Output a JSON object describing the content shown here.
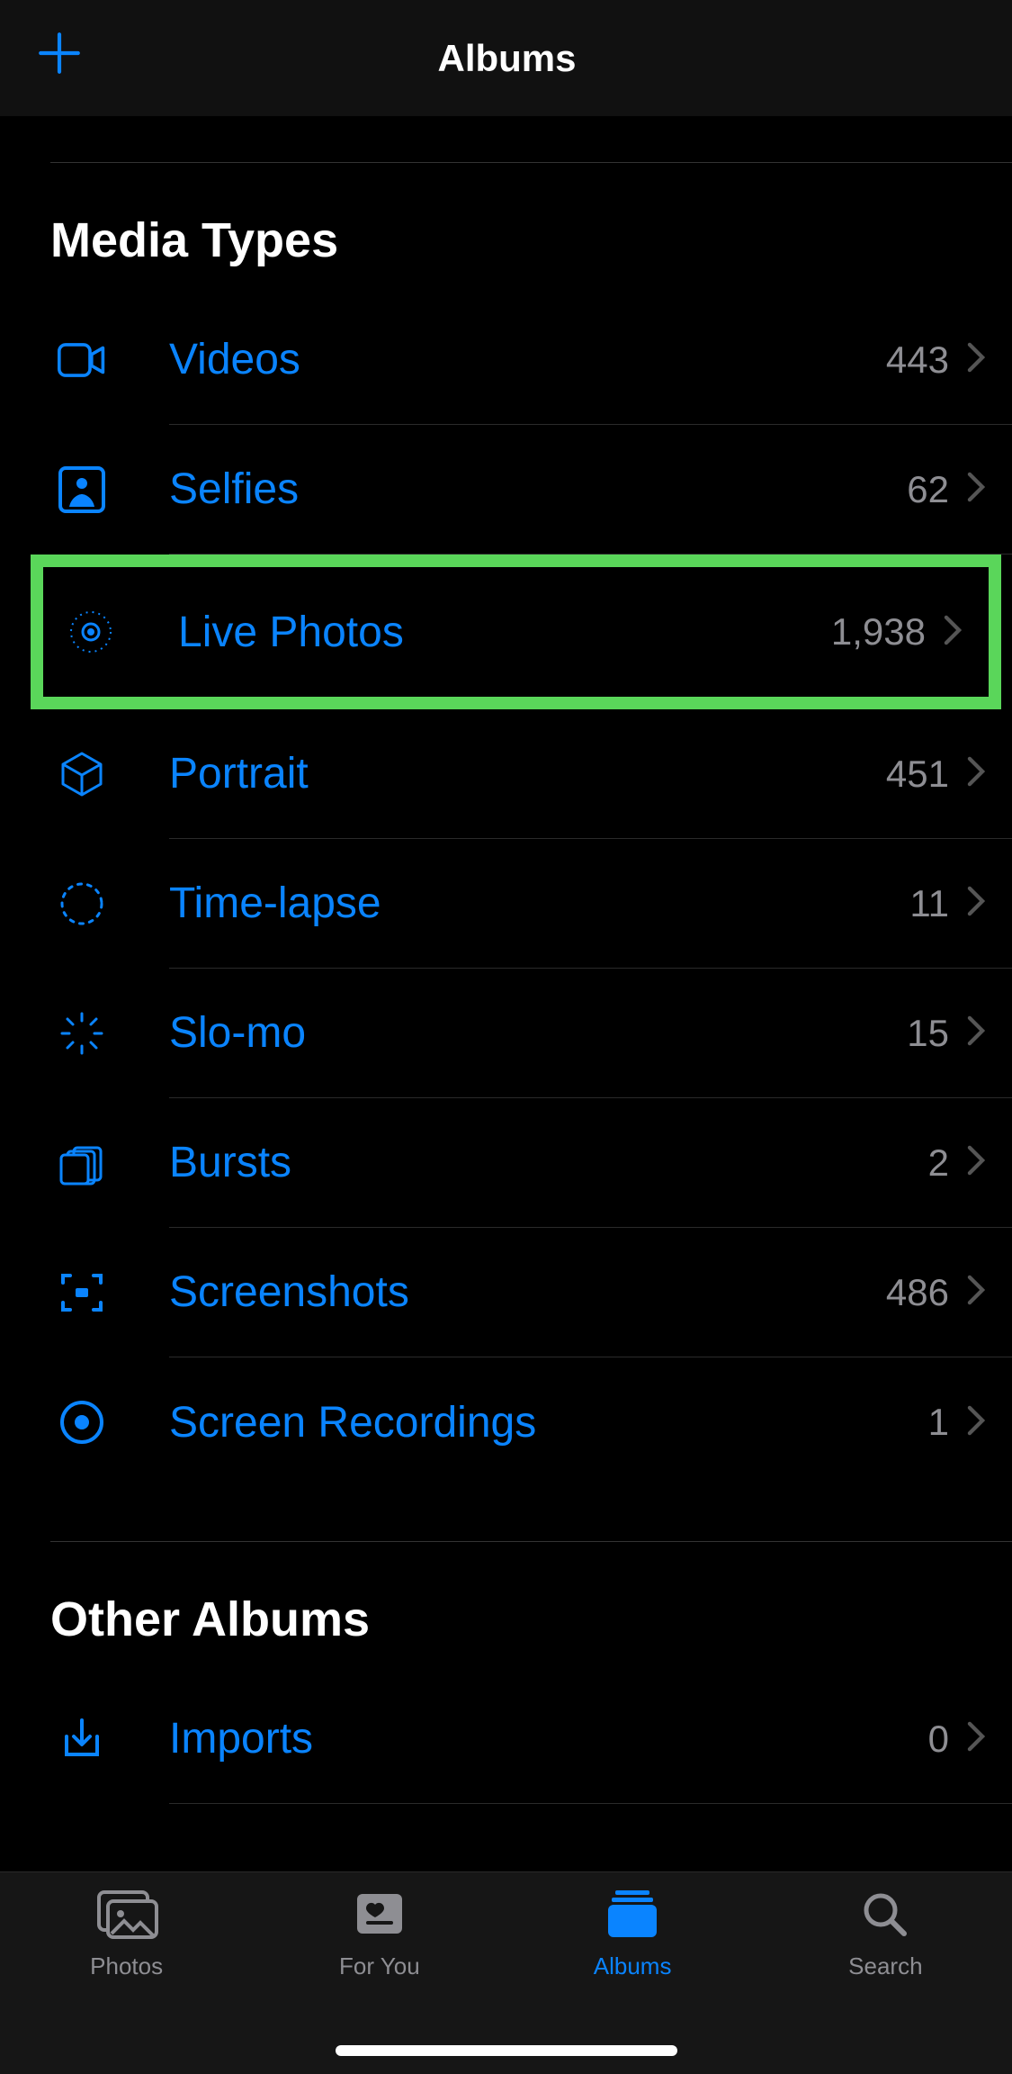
{
  "navbar": {
    "title": "Albums"
  },
  "sections": {
    "media": {
      "header": "Media Types",
      "items": [
        {
          "label": "Videos",
          "count": "443"
        },
        {
          "label": "Selfies",
          "count": "62"
        },
        {
          "label": "Live Photos",
          "count": "1,938"
        },
        {
          "label": "Portrait",
          "count": "451"
        },
        {
          "label": "Time-lapse",
          "count": "11"
        },
        {
          "label": "Slo-mo",
          "count": "15"
        },
        {
          "label": "Bursts",
          "count": "2"
        },
        {
          "label": "Screenshots",
          "count": "486"
        },
        {
          "label": "Screen Recordings",
          "count": "1"
        }
      ]
    },
    "other": {
      "header": "Other Albums",
      "items": [
        {
          "label": "Imports",
          "count": "0"
        }
      ]
    }
  },
  "tabs": {
    "photos": {
      "label": "Photos"
    },
    "foryou": {
      "label": "For You"
    },
    "albums": {
      "label": "Albums"
    },
    "search": {
      "label": "Search"
    }
  },
  "accent": "#0a84ff"
}
